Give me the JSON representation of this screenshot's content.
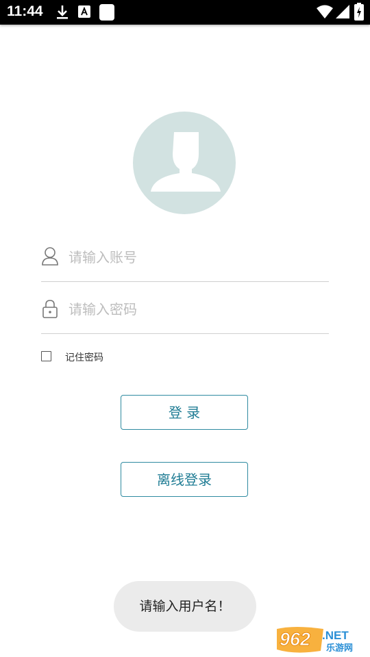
{
  "status_bar": {
    "time": "11:44",
    "icons": [
      "download-icon",
      "a-box-icon",
      "blank-square-icon",
      "wifi-icon",
      "cellular-signal-icon",
      "battery-charging-icon"
    ]
  },
  "login": {
    "username_placeholder": "请输入账号",
    "password_placeholder": "请输入密码",
    "remember_label": "记住密码",
    "login_button": "登 录",
    "offline_login_button": "离线登录"
  },
  "toast": {
    "message": "请输入用户名！"
  },
  "watermark": {
    "brand_number": "962",
    "brand_suffix": ".NET",
    "brand_cn": "乐游网"
  },
  "colors": {
    "accent": "#1f7c94",
    "avatar_bg": "#d2e2e1",
    "toast_bg": "#ebebeb"
  }
}
